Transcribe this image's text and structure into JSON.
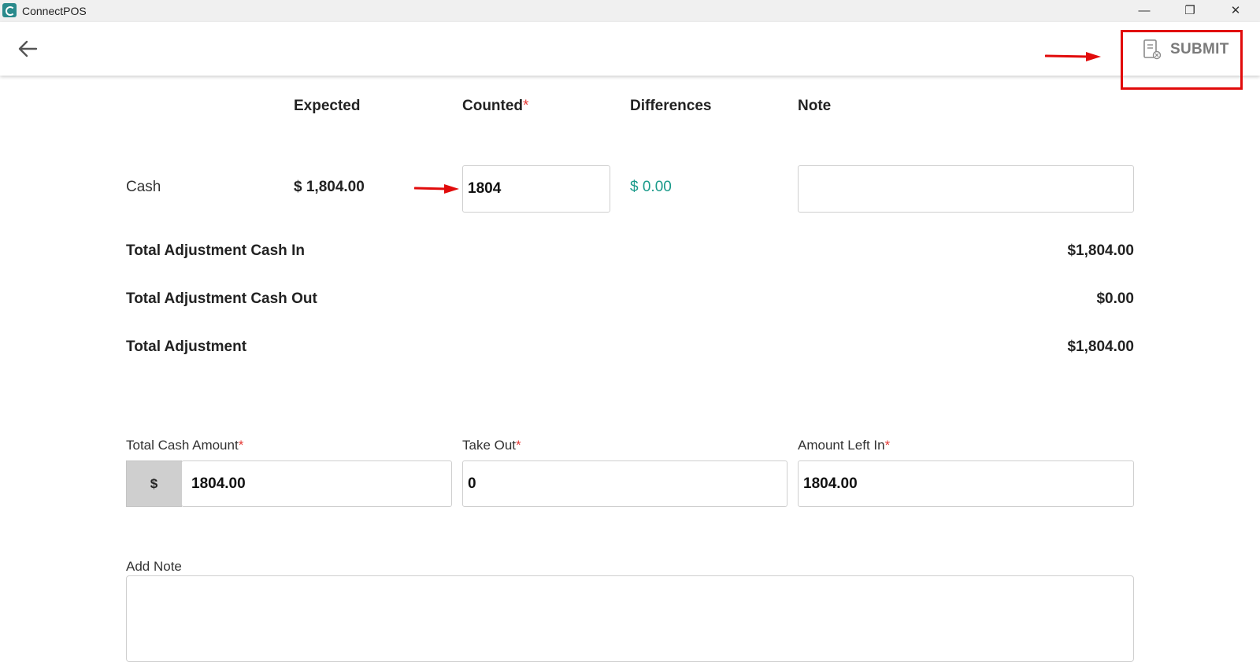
{
  "window": {
    "title": "ConnectPOS",
    "minimize": "—",
    "maximize": "❐",
    "close": "✕"
  },
  "header": {
    "submit_label": "SUBMIT"
  },
  "table": {
    "headers": {
      "expected": "Expected",
      "counted": "Counted",
      "counted_required": "*",
      "differences": "Differences",
      "note": "Note"
    },
    "row": {
      "label": "Cash",
      "expected": "$ 1,804.00",
      "counted": "1804",
      "difference": "$ 0.00",
      "note": ""
    }
  },
  "summary": {
    "cash_in_label": "Total Adjustment Cash In",
    "cash_in_value": "$1,804.00",
    "cash_out_label": "Total Adjustment Cash Out",
    "cash_out_value": "$0.00",
    "total_label": "Total Adjustment",
    "total_value": "$1,804.00"
  },
  "fields": {
    "total_cash": {
      "label": "Total Cash Amount",
      "required": "*",
      "prefix": "$",
      "value": "1804.00"
    },
    "take_out": {
      "label": "Take Out",
      "required": "*",
      "value": "0"
    },
    "amount_left": {
      "label": "Amount Left In",
      "required": "*",
      "value": "1804.00"
    }
  },
  "note": {
    "label": "Add Note",
    "value": ""
  },
  "colors": {
    "accent_teal": "#1a9a8a",
    "annotation_red": "#e10b0b",
    "required_red": "#e53935"
  }
}
